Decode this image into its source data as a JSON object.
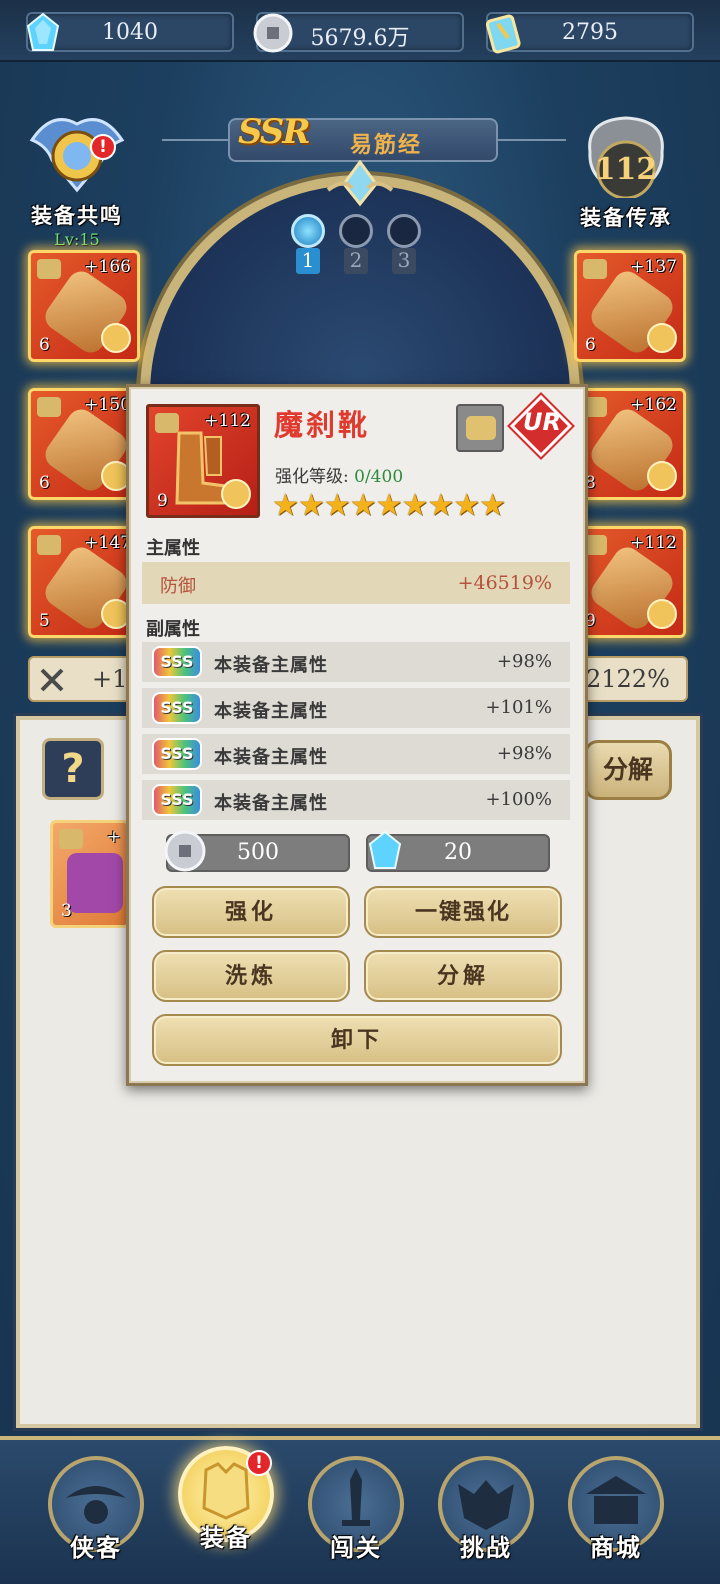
{
  "currencies": [
    {
      "icon": "crystal-icon",
      "value": "1040"
    },
    {
      "icon": "coin-icon",
      "value": "5679.6万"
    },
    {
      "icon": "scroll-icon",
      "value": "2795"
    }
  ],
  "title": {
    "rarity": "SSR",
    "name": "易筋经"
  },
  "left_emblem": {
    "label": "装备共鸣",
    "level": "Lv:15",
    "badge": "!"
  },
  "right_emblem": {
    "value": "112",
    "label": "装备传承"
  },
  "slots": [
    {
      "num": "1",
      "active": true
    },
    {
      "num": "2",
      "active": false
    },
    {
      "num": "3",
      "active": false
    }
  ],
  "left_equips": [
    {
      "plus": "+166",
      "level": "6"
    },
    {
      "plus": "+150",
      "level": "6"
    },
    {
      "plus": "+147",
      "level": "5"
    }
  ],
  "right_equips": [
    {
      "plus": "+137",
      "level": "6"
    },
    {
      "plus": "+162",
      "level": "8"
    },
    {
      "plus": "+112",
      "level": "9"
    }
  ],
  "stat_pills": {
    "left": "+1",
    "right": "2122%"
  },
  "lower": {
    "help": "?",
    "decompose": "分解",
    "bag_item_level": "3",
    "bag_item_plus": "+"
  },
  "popup": {
    "icon_plus": "+112",
    "icon_level": "9",
    "name": "魔刹靴",
    "rank": "UR",
    "strength_label": "强化等级:",
    "strength_value": "0/400",
    "stars": "★★★★★★★★★",
    "main_title": "主属性",
    "main_attr": {
      "name": "防御",
      "value": "+46519%"
    },
    "sub_title": "副属性",
    "sub_attrs": [
      {
        "badge": "SSS",
        "name": "本装备主属性",
        "value": "+98%"
      },
      {
        "badge": "SSS",
        "name": "本装备主属性",
        "value": "+101%"
      },
      {
        "badge": "SSS",
        "name": "本装备主属性",
        "value": "+98%"
      },
      {
        "badge": "SSS",
        "name": "本装备主属性",
        "value": "+100%"
      }
    ],
    "cost_coin": "500",
    "cost_crystal": "20",
    "buttons": {
      "enhance": "强化",
      "one_click": "一键强化",
      "refine": "洗炼",
      "decompose": "分解",
      "unequip": "卸下"
    }
  },
  "nav": [
    {
      "label": "侠客",
      "icon": "hero-icon"
    },
    {
      "label": "装备",
      "icon": "armor-icon",
      "active": true,
      "badge": "!"
    },
    {
      "label": "闯关",
      "icon": "sword-icon"
    },
    {
      "label": "挑战",
      "icon": "demon-icon"
    },
    {
      "label": "商城",
      "icon": "shop-icon"
    }
  ]
}
